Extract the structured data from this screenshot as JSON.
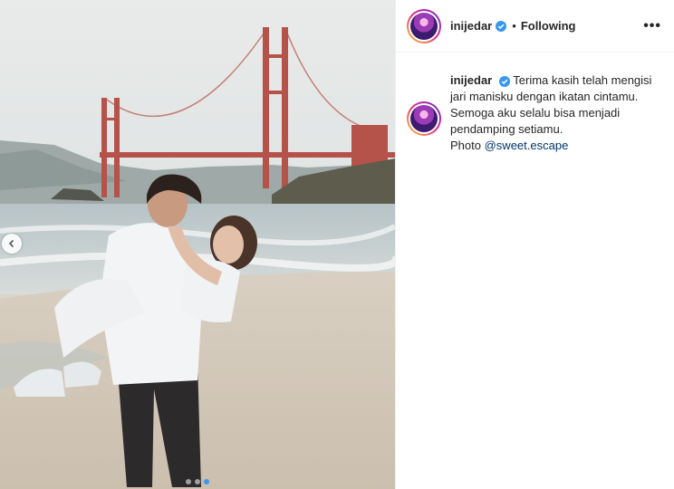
{
  "post": {
    "username": "inijedar",
    "separator": "•",
    "follow_status": "Following",
    "more_label": "•••"
  },
  "caption": {
    "username": "inijedar",
    "text_line_1": "Terima kasih telah mengisi",
    "text_line_2": "jari manisku dengan ikatan cintamu.",
    "text_line_3": "Semoga aku selalu bisa menjadi",
    "text_line_4": "pendamping setiamu.",
    "credit_prefix": "Photo",
    "credit_handle": "@sweet.escape"
  },
  "carousel": {
    "total": 3,
    "active_index": 2
  },
  "colors": {
    "accent": "#3897f0",
    "link": "#003569",
    "text": "#262626",
    "bridge": "#b5524a"
  },
  "icons": {
    "prev": "chevron-left-icon",
    "verified": "verified-badge-icon",
    "more": "more-options-icon"
  }
}
